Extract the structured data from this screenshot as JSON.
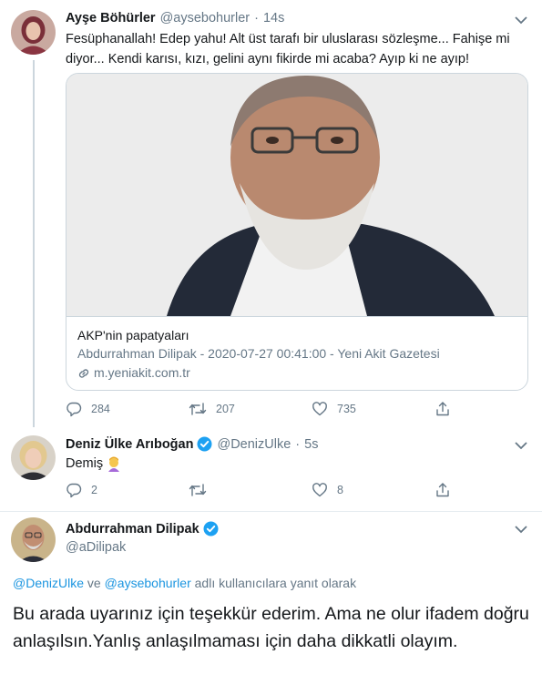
{
  "tweet1": {
    "name": "Ayşe Böhürler",
    "handle": "@aysebohurler",
    "dot": "·",
    "time": "14s",
    "text": "Fesüphanallah! Edep yahu! Alt üst tarafı bir uluslarası sözleşme... Fahişe mi diyor... Kendi karısı, kızı, gelini aynı fikirde mi acaba? Ayıp ki ne ayıp!",
    "card": {
      "title": "AKP'nin papatyaları",
      "description": "Abdurrahman Dilipak - 2020-07-27 00:41:00 - Yeni Akit Gazetesi",
      "link": "m.yeniakit.com.tr"
    },
    "actions": {
      "replies": "284",
      "retweets": "207",
      "likes": "735"
    }
  },
  "tweet2": {
    "name": "Deniz Ülke Arıboğan",
    "handle": "@DenizUlke",
    "dot": "·",
    "time": "5s",
    "text": "Demiş",
    "emoji": "woman-facepalming",
    "actions": {
      "replies": "2",
      "retweets": "",
      "likes": "8"
    }
  },
  "tweet3": {
    "name": "Abdurrahman Dilipak",
    "handle": "@aDilipak",
    "replying": {
      "mention1": "@DenizUlke",
      "connector": " ve ",
      "mention2": "@aysebohurler",
      "suffix": " adlı kullanıcılara yanıt olarak"
    },
    "text": "Bu arada uyarınız için teşekkür ederim. Ama ne olur ifadem doğru anlaşılsın.Yanlış anlaşılmaması için daha dikkatli olayım."
  },
  "icons": {
    "reply": "reply-icon",
    "retweet": "retweet-icon",
    "like": "heart-icon",
    "share": "share-icon",
    "verified": "verified-badge-icon",
    "caret": "chevron-down-icon",
    "link": "link-icon"
  },
  "colors": {
    "text": "#14171a",
    "secondary": "#657786",
    "link": "#1b95e0",
    "border": "#ccd6dd",
    "verified": "#1da1f2"
  }
}
